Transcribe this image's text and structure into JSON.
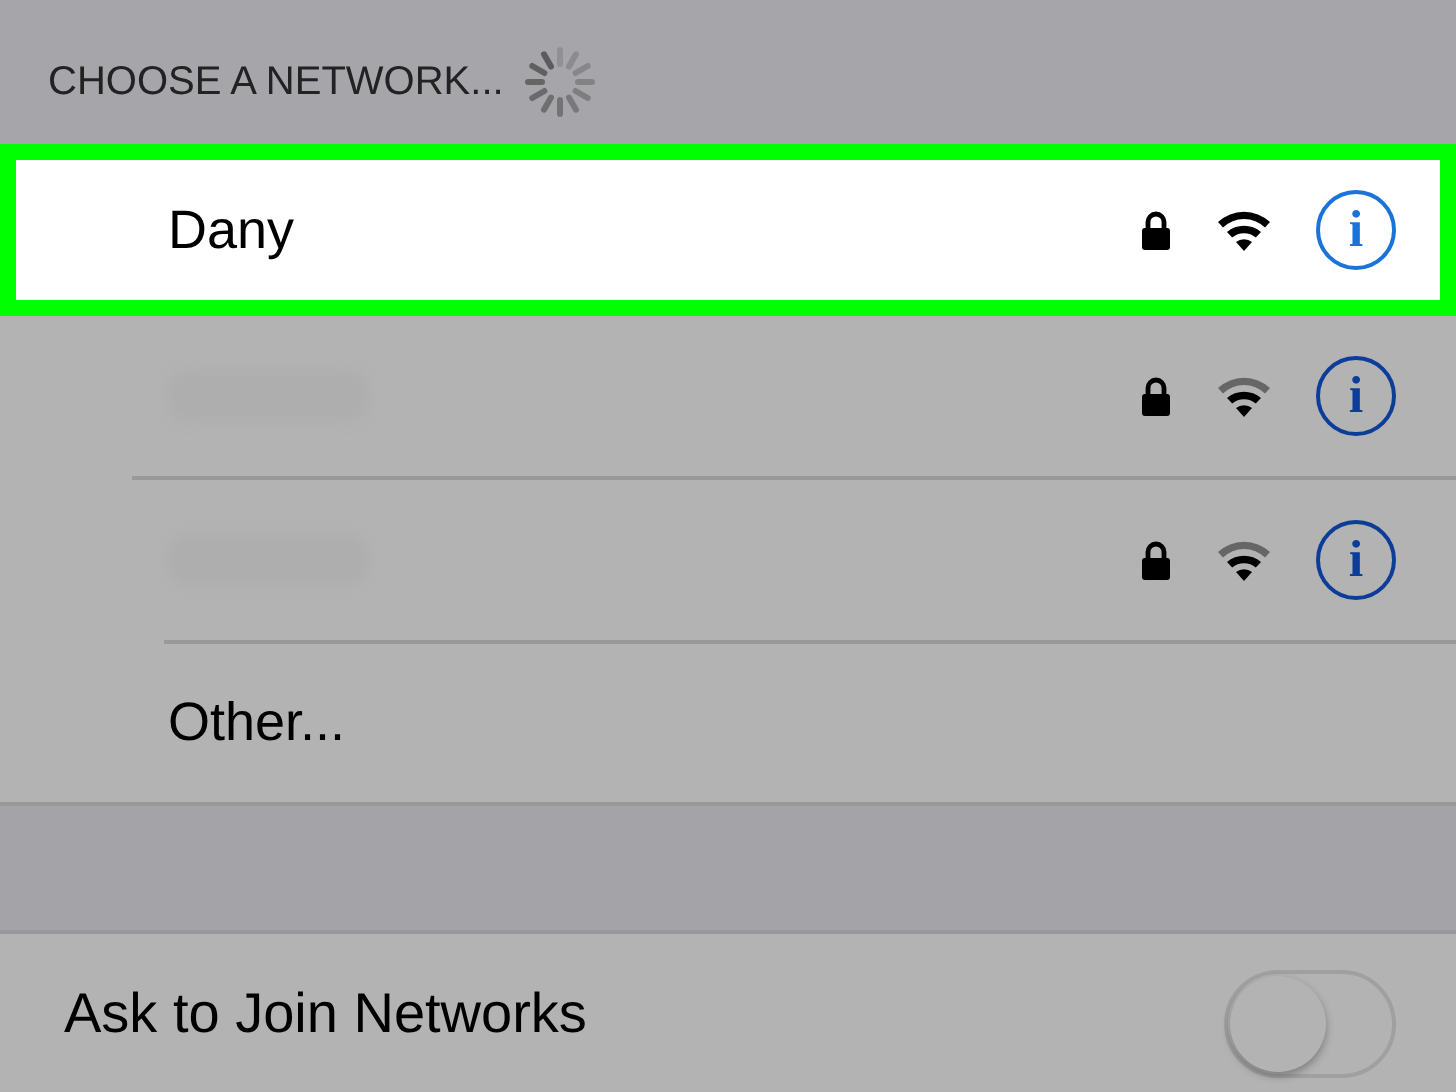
{
  "section_header": {
    "label": "CHOOSE A NETWORK...",
    "loading": true
  },
  "networks": [
    {
      "name": "Dany",
      "highlighted": true,
      "locked": true,
      "info_button": "i"
    },
    {
      "highlighted": false,
      "locked": true,
      "info_button": "i"
    },
    {
      "highlighted": false,
      "locked": true,
      "info_button": "i"
    }
  ],
  "other": {
    "label": "Other..."
  },
  "ask_to_join": {
    "label": "Ask to Join Networks",
    "on": false
  }
}
